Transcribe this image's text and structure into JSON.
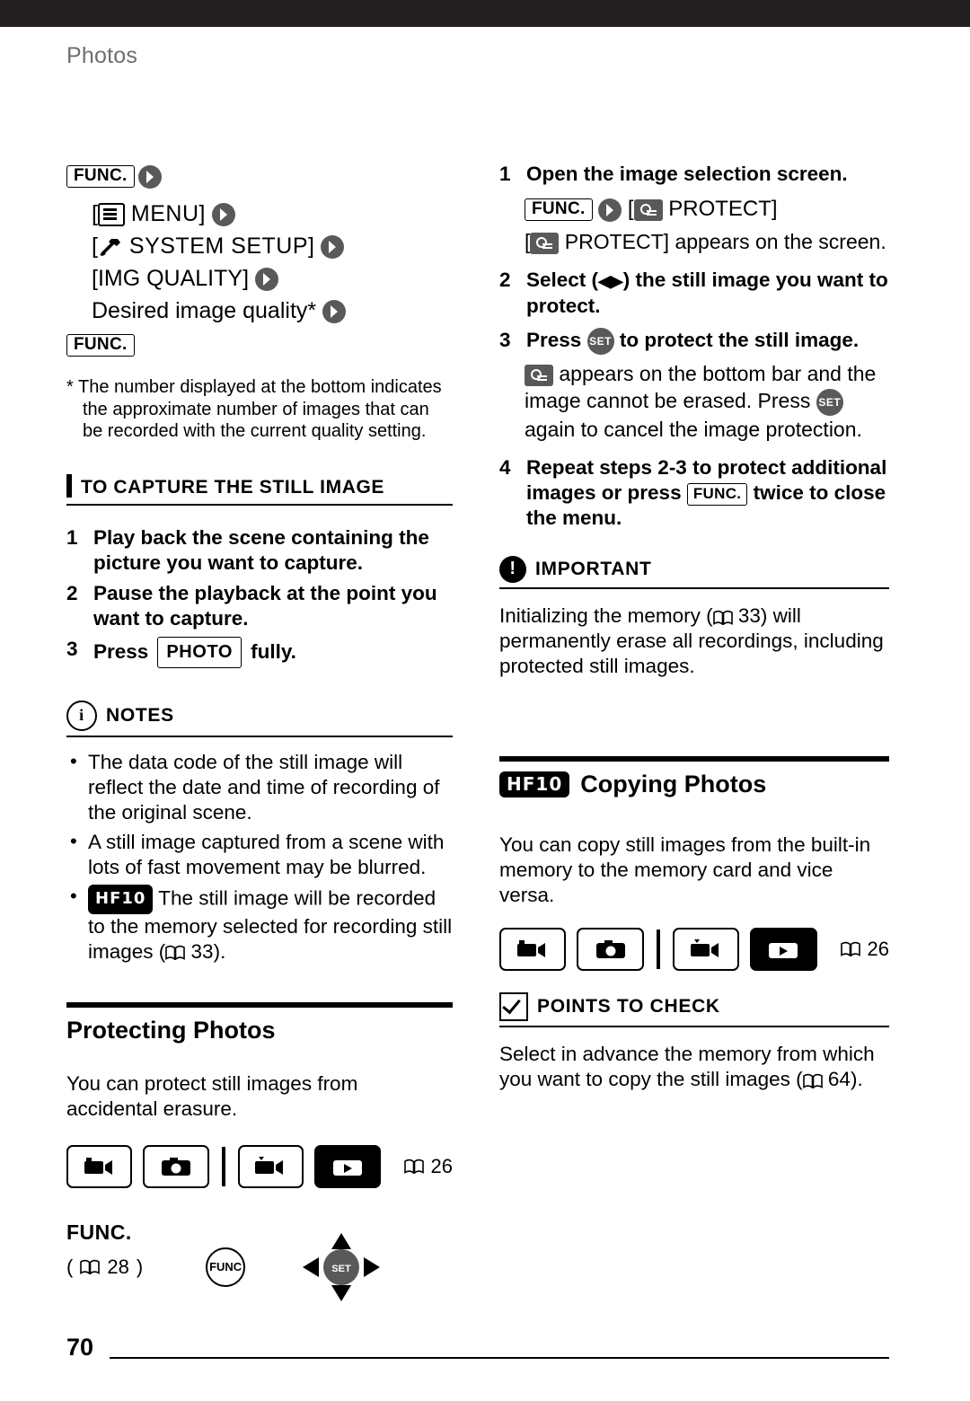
{
  "header": {
    "running_head": "Photos"
  },
  "page_number": "70",
  "left": {
    "menu_path": {
      "func_label": "FUNC.",
      "line1": "[     MENU]",
      "line2": "[     SYSTEM SETUP]",
      "line3": "[IMG QUALITY]",
      "line4": "Desired image quality*",
      "func_label_end": "FUNC."
    },
    "footnote": "* The number displayed at the bottom indicates the approximate number of images that can be recorded with the current quality setting.",
    "capture_head": "TO CAPTURE THE STILL IMAGE",
    "capture_steps": [
      {
        "num": "1",
        "text": "Play back the scene containing the picture you want to capture."
      },
      {
        "num": "2",
        "text": "Pause the playback at the point you want to capture."
      },
      {
        "num": "3",
        "text": "Press",
        "button": "PHOTO",
        "text_after": "fully."
      }
    ],
    "notes_head": "NOTES",
    "notes": [
      "The data code of the still image will reflect the date and time of recording of the original scene.",
      "A still image captured from a scene with lots of fast movement may be blurred.",
      "The still image will be recorded to the memory selected for recording still images ("
    ],
    "notes_hf10_tag": "HF10",
    "notes_last_ref": "33",
    "notes_last_close": ").",
    "protecting_title": "Protecting Photos",
    "protecting_body": "You can protect still images from accidental erasure.",
    "modes_ref": "26",
    "func_heading": "FUNC.",
    "func_ref": "28",
    "func_button_label": "FUNC",
    "joystick_label": "SET"
  },
  "right": {
    "steps": [
      {
        "num": "1",
        "text": "Open the image selection screen."
      },
      {
        "num": "2",
        "text": "Select (   ) the still image you want to protect."
      },
      {
        "num": "3",
        "text": "Press",
        "text_after": "to protect the still image."
      },
      {
        "num": "4",
        "text": "Repeat steps 2-3 to protect additional images or press",
        "text_after": "twice to close the menu."
      }
    ],
    "step1_func": "FUNC.",
    "step1_protect": "PROTECT]",
    "step1_note": "PROTECT] appears on the screen.",
    "step3_note_a": "appears on the bottom bar and the image cannot be erased. Press",
    "step3_note_b": "again to cancel the image protection.",
    "step4_func": "FUNC.",
    "important_head": "IMPORTANT",
    "important_body_a": "Initializing the memory (",
    "important_ref": "33",
    "important_body_b": ") will permanently erase all recordings, including protected still images.",
    "copying_tag": "HF10",
    "copying_title": "Copying Photos",
    "copying_body": "You can copy still images from the built-in memory to the memory card and vice versa.",
    "modes_ref": "26",
    "points_head": "POINTS TO CHECK",
    "points_body_a": "Select in advance the memory from which you want to copy the still images (",
    "points_ref": "64",
    "points_body_b": ")."
  },
  "icons": {
    "func": "func-box",
    "arrow": "arrow-right-circle",
    "menu": "menu-list-icon",
    "system": "wrench-icon",
    "key": "protect-key-icon",
    "set": "set-button-icon",
    "book": "manual-page-icon",
    "camera": "camera-mode-icon",
    "movie": "movie-mode-icon",
    "play_movie": "movie-playback-icon",
    "play_photo": "photo-playback-icon"
  }
}
